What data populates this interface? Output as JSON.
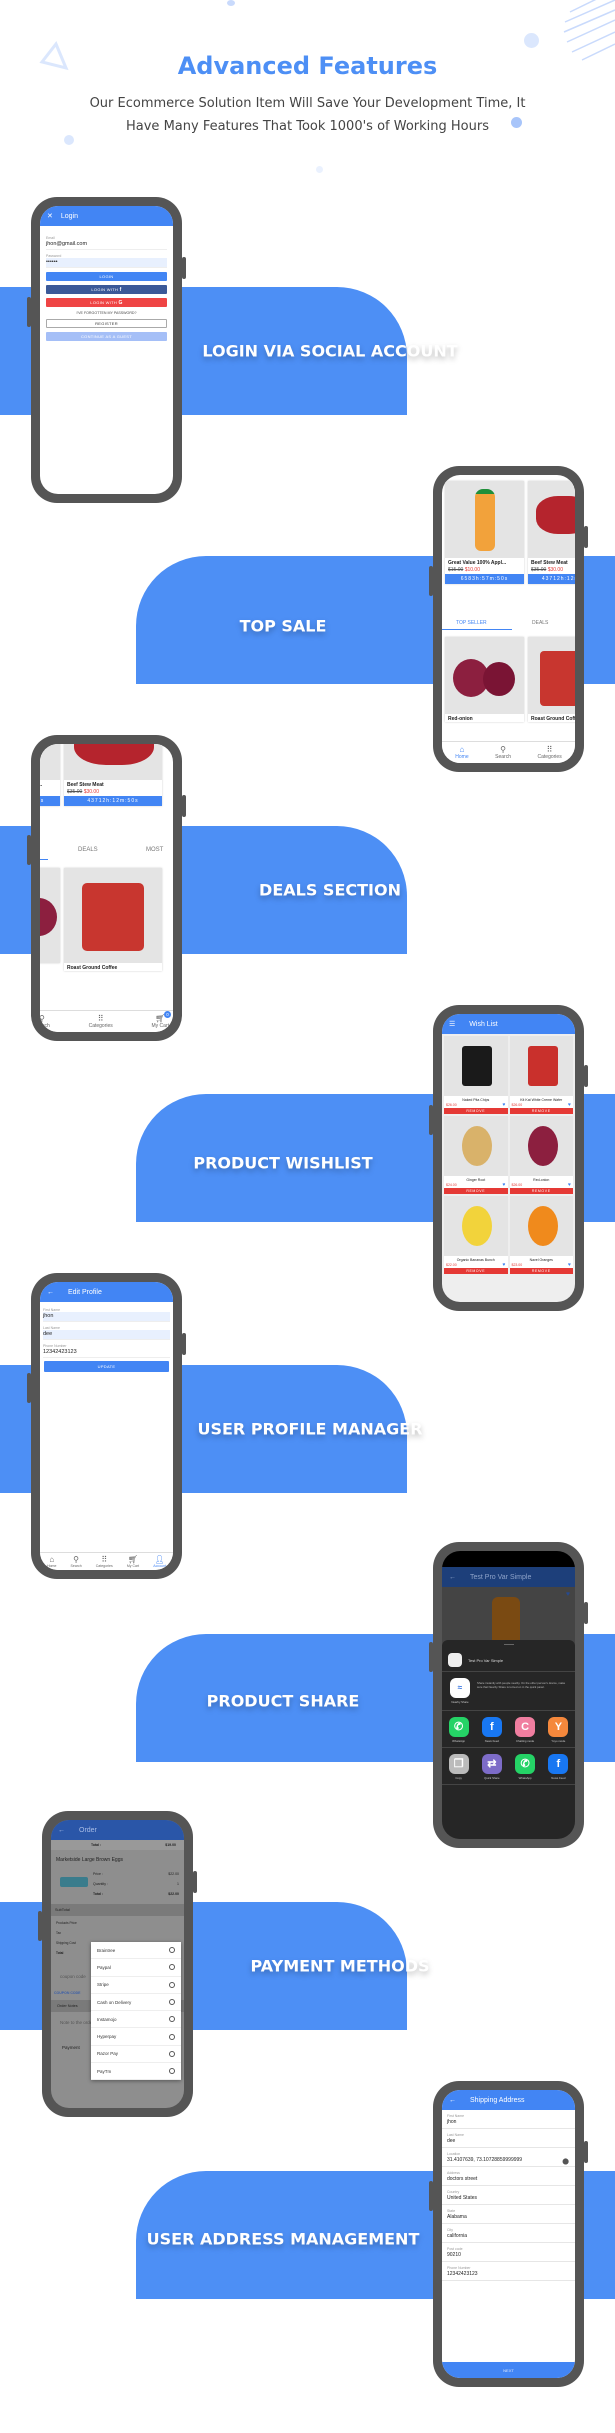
{
  "header": {
    "title": "Advanced Features",
    "subtitle_line1": "Our Ecommerce Solution Item Will Save Your Development Time, It",
    "subtitle_line2": "Have Many Features That Took 1000's of Working Hours"
  },
  "colors": {
    "accent": "#4d8ff5",
    "app_bar": "#4285f4",
    "facebook": "#3b5998",
    "google": "#ef4444",
    "price_red": "#e53935",
    "phone_frame": "#555555"
  },
  "features": [
    {
      "label": "LOGIN VIA SOCIAL ACCOUNT"
    },
    {
      "label": "TOP SALE"
    },
    {
      "label": "DEALS SECTION"
    },
    {
      "label": "PRODUCT WISHLIST"
    },
    {
      "label": "USER PROFILE MANAGER"
    },
    {
      "label": "PRODUCT SHARE"
    },
    {
      "label": "PAYMENT METHODS"
    },
    {
      "label": "USER ADDRESS MANAGEMENT"
    }
  ],
  "login": {
    "title": "Login",
    "close_icon": "close-icon",
    "email_label": "Email",
    "email_value": "jhon@gmail.com",
    "password_label": "Password",
    "password_value": "••••••",
    "login_button": "LOGIN",
    "facebook_button": "LOGIN WITH",
    "google_button": "LOGIN WITH",
    "forgot_link": "I'VE FORGOTTEN MY PASSWORD?",
    "register_button": "REGISTER",
    "guest_button": "CONTINUE AS A GUEST"
  },
  "products": {
    "items": [
      {
        "name": "Great Value 100% Appl...",
        "old_price": "$15.00",
        "new_price": "$10.00",
        "timer": "6583h:57m:50s"
      },
      {
        "name": "Beef Stew Meat",
        "old_price": "$35.00",
        "new_price": "$30.00",
        "timer": "43712h:12m:50s"
      }
    ],
    "tabs": [
      "TOP SELLER",
      "DEALS",
      "MOST"
    ],
    "row2": [
      {
        "name": "Red-onion"
      },
      {
        "name": "Roast Ground Coffee"
      }
    ],
    "nav": [
      "Home",
      "Search",
      "Categories",
      "My Cart"
    ],
    "cart_count": "0"
  },
  "wishlist": {
    "title": "Wish List",
    "remove_label": "REMOVE",
    "items": [
      {
        "name": "Naked Pita Chips",
        "price": "$26.00"
      },
      {
        "name": "Kit Kat White Creme Wafer",
        "price": "$26.00"
      },
      {
        "name": "Ginger Root",
        "price": "$24.00"
      },
      {
        "name": "Red-onion",
        "price": "$26.00"
      },
      {
        "name": "Organic Bananas Bunch",
        "price": "$22.00"
      },
      {
        "name": "Navel Oranges",
        "price": "$23.00"
      }
    ]
  },
  "profile": {
    "title": "Edit Profile",
    "first_name_label": "First Name",
    "first_name": "jhon",
    "last_name_label": "Last Name",
    "last_name": "dee",
    "phone_label": "Phone Number",
    "phone": "12342423123",
    "update_button": "UPDATE",
    "nav": [
      "Home",
      "Search",
      "Categories",
      "My Cart",
      "Account"
    ]
  },
  "share": {
    "product_title": "Test Pro Var Simple",
    "nearby_label": "Nearby Share",
    "nearby_text": "Share instantly with people nearby. On the other person's device, make sure that Nearby Share is turned on in the quick panel.",
    "apps_row1": [
      "WhatsApp",
      "News Feed",
      "Chatting mode",
      "Yoyo mode"
    ],
    "apps_row2": [
      "Copy",
      "Quick Share",
      "WhatsApp",
      "News Feed"
    ]
  },
  "order": {
    "title": "Order",
    "total_label": "Total :",
    "first_total": "$19.00",
    "product_name": "Marketside Large Brown Eggs",
    "price_label": "Price :",
    "price": "$22.00",
    "quantity_label": "Quantity :",
    "quantity": "1",
    "product_total": "$22.00",
    "subtotal_header": "SubTotal",
    "subtotal_rows": [
      "Products Price",
      "Tax",
      "Shipping Cost",
      "Total"
    ],
    "coupon_placeholder": "coupon code",
    "coupon_link": "COUPON CODE",
    "notes_header": "Order Notes",
    "notes_placeholder": "Note to the order",
    "payment_label": "Payment",
    "payment_methods": [
      "Braintree",
      "Paypal",
      "Stripe",
      "Cash on Delivery",
      "Instamojo",
      "Hyperpay",
      "Razor Pay",
      "PayTm"
    ]
  },
  "address": {
    "title": "Shipping Address",
    "fields": [
      {
        "label": "First Name",
        "value": "jhon"
      },
      {
        "label": "Last Name",
        "value": "dee"
      },
      {
        "label": "Location",
        "value": "31.4107639, 73.10728859999999"
      },
      {
        "label": "Address",
        "value": "doctors street"
      },
      {
        "label": "Country",
        "value": "United States"
      },
      {
        "label": "State",
        "value": "Alabama"
      },
      {
        "label": "City",
        "value": "california"
      },
      {
        "label": "Post code",
        "value": "90210"
      },
      {
        "label": "Phone Number",
        "value": "12342423123"
      }
    ],
    "next_button": "NEXT"
  }
}
